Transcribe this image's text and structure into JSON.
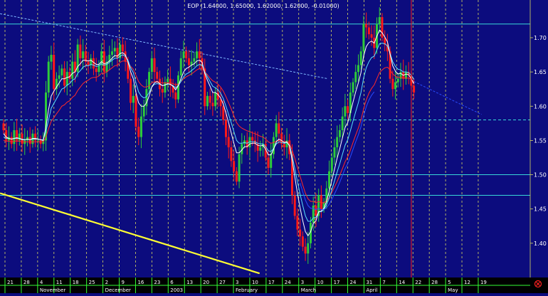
{
  "colors": {
    "background": "#0c0c7e",
    "grid": "#d8d860",
    "hline": "#38d8d8",
    "up_candle": "#2ecc3a",
    "down_candle": "#ff1818",
    "ma_fast": "#ffffff",
    "ma_mid": "#59e0ff",
    "ma_slow": "#ff2a2a",
    "trend_support": "#ffff33",
    "trend_resistance": "#7fb8ff",
    "channel_low": "#2a4cff",
    "axis_text": "#ffffff",
    "axis_bg": "#000000",
    "tick_green": "#33ff33",
    "close_icon": "#ff2222"
  },
  "chart_data": {
    "type": "candlestick",
    "title": "EOP (1.64000, 1.65000, 1.62000, 1.62000, -0.01000)",
    "ylim": [
      1.35,
      1.755
    ],
    "y_ticks": [
      1.4,
      1.45,
      1.5,
      1.55,
      1.6,
      1.65,
      1.7
    ],
    "y_tick_labels": [
      "1.40",
      "1.45",
      "1.50",
      "1.55",
      "1.60",
      "1.65",
      "1.70"
    ],
    "x_day_labels": [
      "21",
      "28",
      "4",
      "11",
      "18",
      "25",
      "2",
      "9",
      "16",
      "23",
      "6",
      "13",
      "20",
      "27",
      "3",
      "10",
      "17",
      "24",
      "3",
      "10",
      "17",
      "24",
      "31",
      "7",
      "14",
      "22",
      "28",
      "5",
      "12",
      "19"
    ],
    "x_month_labels": [
      "November",
      "December",
      "2003",
      "February",
      "March",
      "April",
      "May"
    ],
    "x_month_label_index": [
      2,
      6,
      10,
      14,
      18,
      22,
      27
    ],
    "horizontal_levels": [
      {
        "value": 1.72,
        "style": "solid"
      },
      {
        "value": 1.58,
        "style": "dashed"
      },
      {
        "value": 1.5,
        "style": "solid"
      },
      {
        "value": 1.47,
        "style": "solid"
      }
    ],
    "vertical_marker_week": 24.9,
    "trendlines": [
      {
        "name": "support",
        "from": [
          -0.3,
          1.473
        ],
        "to": [
          15.6,
          1.356
        ]
      },
      {
        "name": "resistance",
        "from": [
          -0.3,
          1.735
        ],
        "to": [
          19.8,
          1.64
        ]
      }
    ],
    "closes": [
      1.565,
      1.55,
      1.555,
      1.545,
      1.565,
      1.55,
      1.56,
      1.545,
      1.55,
      1.555,
      1.545,
      1.56,
      1.55,
      1.55,
      1.545,
      1.55,
      1.62,
      1.665,
      1.675,
      1.625,
      1.64,
      1.645,
      1.655,
      1.63,
      1.65,
      1.64,
      1.665,
      1.65,
      1.69,
      1.67,
      1.68,
      1.665,
      1.66,
      1.67,
      1.655,
      1.65,
      1.66,
      1.68,
      1.65,
      1.665,
      1.675,
      1.68,
      1.685,
      1.67,
      1.69,
      1.68,
      1.665,
      1.64,
      1.605,
      1.615,
      1.57,
      1.555,
      1.585,
      1.6,
      1.625,
      1.65,
      1.67,
      1.65,
      1.64,
      1.625,
      1.62,
      1.635,
      1.64,
      1.63,
      1.62,
      1.61,
      1.645,
      1.67,
      1.68,
      1.67,
      1.66,
      1.665,
      1.67,
      1.68,
      1.67,
      1.655,
      1.6,
      1.615,
      1.605,
      1.6,
      1.62,
      1.61,
      1.6,
      1.58,
      1.555,
      1.54,
      1.52,
      1.505,
      1.49,
      1.53,
      1.545,
      1.55,
      1.54,
      1.555,
      1.55,
      1.545,
      1.535,
      1.54,
      1.545,
      1.525,
      1.51,
      1.53,
      1.555,
      1.575,
      1.56,
      1.545,
      1.54,
      1.55,
      1.53,
      1.47,
      1.44,
      1.42,
      1.41,
      1.395,
      1.385,
      1.4,
      1.43,
      1.455,
      1.44,
      1.47,
      1.45,
      1.46,
      1.48,
      1.505,
      1.525,
      1.54,
      1.555,
      1.565,
      1.585,
      1.6,
      1.59,
      1.62,
      1.635,
      1.65,
      1.66,
      1.68,
      1.72,
      1.715,
      1.705,
      1.7,
      1.685,
      1.72,
      1.73,
      1.7,
      1.69,
      1.68,
      1.64,
      1.625,
      1.635,
      1.64,
      1.65,
      1.64,
      1.65,
      1.645,
      1.63,
      1.62
    ],
    "ma_fast": [
      1.56,
      1.555,
      1.553,
      1.552,
      1.553,
      1.554,
      1.553,
      1.551,
      1.551,
      1.552,
      1.551,
      1.553,
      1.553,
      1.552,
      1.551,
      1.55,
      1.57,
      1.595,
      1.615,
      1.622,
      1.628,
      1.634,
      1.64,
      1.64,
      1.642,
      1.643,
      1.648,
      1.65,
      1.658,
      1.662,
      1.667,
      1.667,
      1.666,
      1.667,
      1.664,
      1.661,
      1.661,
      1.665,
      1.662,
      1.663,
      1.666,
      1.67,
      1.674,
      1.673,
      1.677,
      1.678,
      1.675,
      1.665,
      1.65,
      1.64,
      1.62,
      1.605,
      1.6,
      1.6,
      1.605,
      1.615,
      1.628,
      1.634,
      1.636,
      1.633,
      1.63,
      1.631,
      1.633,
      1.632,
      1.629,
      1.624,
      1.63,
      1.64,
      1.65,
      1.655,
      1.657,
      1.66,
      1.662,
      1.666,
      1.667,
      1.664,
      1.648,
      1.638,
      1.629,
      1.62,
      1.62,
      1.617,
      1.612,
      1.603,
      1.59,
      1.576,
      1.561,
      1.546,
      1.532,
      1.532,
      1.536,
      1.541,
      1.541,
      1.545,
      1.546,
      1.546,
      1.543,
      1.542,
      1.543,
      1.537,
      1.529,
      1.529,
      1.537,
      1.548,
      1.552,
      1.55,
      1.547,
      1.548,
      1.542,
      1.521,
      1.497,
      1.473,
      1.452,
      1.433,
      1.417,
      1.411,
      1.417,
      1.429,
      1.433,
      1.446,
      1.447,
      1.451,
      1.461,
      1.476,
      1.492,
      1.508,
      1.524,
      1.538,
      1.554,
      1.569,
      1.576,
      1.591,
      1.606,
      1.621,
      1.634,
      1.649,
      1.673,
      1.687,
      1.693,
      1.695,
      1.692,
      1.702,
      1.711,
      1.707,
      1.701,
      1.694,
      1.676,
      1.659,
      1.651,
      1.647,
      1.648,
      1.645,
      1.647,
      1.646,
      1.64,
      1.633
    ],
    "ma_mid": [
      1.555,
      1.553,
      1.553,
      1.552,
      1.553,
      1.553,
      1.553,
      1.552,
      1.551,
      1.552,
      1.551,
      1.552,
      1.552,
      1.552,
      1.551,
      1.551,
      1.563,
      1.58,
      1.597,
      1.604,
      1.611,
      1.618,
      1.625,
      1.627,
      1.631,
      1.633,
      1.638,
      1.64,
      1.648,
      1.652,
      1.657,
      1.659,
      1.659,
      1.661,
      1.66,
      1.658,
      1.659,
      1.662,
      1.66,
      1.661,
      1.664,
      1.667,
      1.67,
      1.67,
      1.673,
      1.675,
      1.673,
      1.667,
      1.656,
      1.649,
      1.634,
      1.621,
      1.615,
      1.612,
      1.614,
      1.62,
      1.628,
      1.632,
      1.633,
      1.632,
      1.63,
      1.631,
      1.632,
      1.632,
      1.63,
      1.627,
      1.63,
      1.636,
      1.643,
      1.647,
      1.649,
      1.652,
      1.655,
      1.659,
      1.661,
      1.66,
      1.65,
      1.643,
      1.636,
      1.629,
      1.627,
      1.624,
      1.619,
      1.611,
      1.6,
      1.588,
      1.576,
      1.563,
      1.55,
      1.546,
      1.546,
      1.547,
      1.546,
      1.548,
      1.548,
      1.548,
      1.546,
      1.545,
      1.545,
      1.541,
      1.535,
      1.534,
      1.538,
      1.545,
      1.548,
      1.547,
      1.546,
      1.547,
      1.543,
      1.528,
      1.509,
      1.49,
      1.472,
      1.455,
      1.44,
      1.432,
      1.432,
      1.437,
      1.438,
      1.446,
      1.446,
      1.449,
      1.456,
      1.466,
      1.478,
      1.491,
      1.504,
      1.516,
      1.53,
      1.543,
      1.551,
      1.564,
      1.578,
      1.592,
      1.605,
      1.62,
      1.641,
      1.656,
      1.665,
      1.671,
      1.673,
      1.682,
      1.691,
      1.692,
      1.691,
      1.688,
      1.677,
      1.665,
      1.658,
      1.654,
      1.653,
      1.65,
      1.65,
      1.649,
      1.645,
      1.639
    ],
    "ma_slow": [
      1.55,
      1.549,
      1.549,
      1.548,
      1.549,
      1.549,
      1.549,
      1.548,
      1.548,
      1.548,
      1.548,
      1.548,
      1.548,
      1.548,
      1.548,
      1.548,
      1.555,
      1.567,
      1.578,
      1.583,
      1.589,
      1.594,
      1.6,
      1.602,
      1.606,
      1.608,
      1.613,
      1.616,
      1.623,
      1.628,
      1.633,
      1.636,
      1.638,
      1.641,
      1.642,
      1.642,
      1.644,
      1.648,
      1.648,
      1.65,
      1.653,
      1.656,
      1.659,
      1.66,
      1.664,
      1.666,
      1.666,
      1.664,
      1.658,
      1.654,
      1.645,
      1.636,
      1.631,
      1.628,
      1.628,
      1.63,
      1.634,
      1.636,
      1.636,
      1.635,
      1.634,
      1.634,
      1.634,
      1.634,
      1.633,
      1.631,
      1.632,
      1.636,
      1.64,
      1.643,
      1.645,
      1.647,
      1.65,
      1.653,
      1.655,
      1.655,
      1.65,
      1.646,
      1.641,
      1.637,
      1.635,
      1.632,
      1.628,
      1.622,
      1.614,
      1.605,
      1.596,
      1.586,
      1.576,
      1.571,
      1.568,
      1.566,
      1.564,
      1.563,
      1.561,
      1.56,
      1.558,
      1.556,
      1.555,
      1.552,
      1.548,
      1.546,
      1.547,
      1.549,
      1.55,
      1.549,
      1.548,
      1.548,
      1.546,
      1.536,
      1.524,
      1.511,
      1.498,
      1.485,
      1.473,
      1.465,
      1.461,
      1.461,
      1.459,
      1.461,
      1.459,
      1.459,
      1.462,
      1.467,
      1.474,
      1.482,
      1.49,
      1.499,
      1.509,
      1.519,
      1.526,
      1.536,
      1.547,
      1.558,
      1.568,
      1.58,
      1.596,
      1.609,
      1.619,
      1.626,
      1.631,
      1.64,
      1.649,
      1.653,
      1.656,
      1.657,
      1.653,
      1.647,
      1.644,
      1.642,
      1.642,
      1.641,
      1.641,
      1.641,
      1.639,
      1.636
    ]
  }
}
